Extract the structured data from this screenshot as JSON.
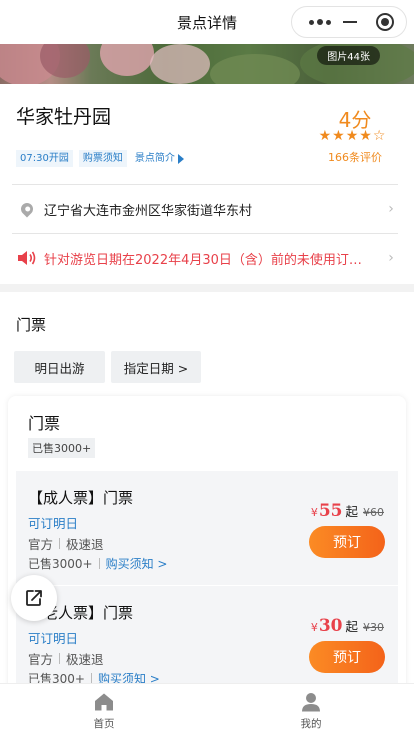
{
  "nav": {
    "title": "景点详情"
  },
  "banner": {
    "photo_count": "图片44张"
  },
  "spot": {
    "name": "华家牡丹园",
    "score": "4分",
    "rating_stars": 4,
    "rating_max": 5,
    "reviews": "166条评价",
    "tags": [
      "07:30开园",
      "购票须知",
      "景点简介"
    ],
    "address": "辽宁省大连市金州区华家街道华东村",
    "notice": "针对游览日期在2022年4月30日（含）前的未使用订…"
  },
  "tickets": {
    "section_title": "门票",
    "date_options": [
      "明日出游",
      "指定日期 >"
    ],
    "card_title": "门票",
    "sold": "已售3000+",
    "items": [
      {
        "name": "【成人票】门票",
        "availability": "可订明日",
        "source": "官方",
        "refund": "极速退",
        "sold": "已售3000+",
        "notice_link": "购买须知 >",
        "currency": "¥",
        "price": "55",
        "price_suffix": "起",
        "original_price": "¥60",
        "button": "预订"
      },
      {
        "name": "【老人票】门票",
        "availability": "可订明日",
        "source": "官方",
        "refund": "极速退",
        "sold": "已售300+",
        "notice_link": "购买须知 >",
        "currency": "¥",
        "price": "30",
        "price_suffix": "起",
        "original_price": "¥30",
        "button": "预订"
      }
    ]
  },
  "tabbar": {
    "home": "首页",
    "mine": "我的"
  },
  "colors": {
    "accent": "#f08a1e",
    "link": "#2a7ec7",
    "alert": "#e8414a",
    "button": "#f4631a"
  }
}
